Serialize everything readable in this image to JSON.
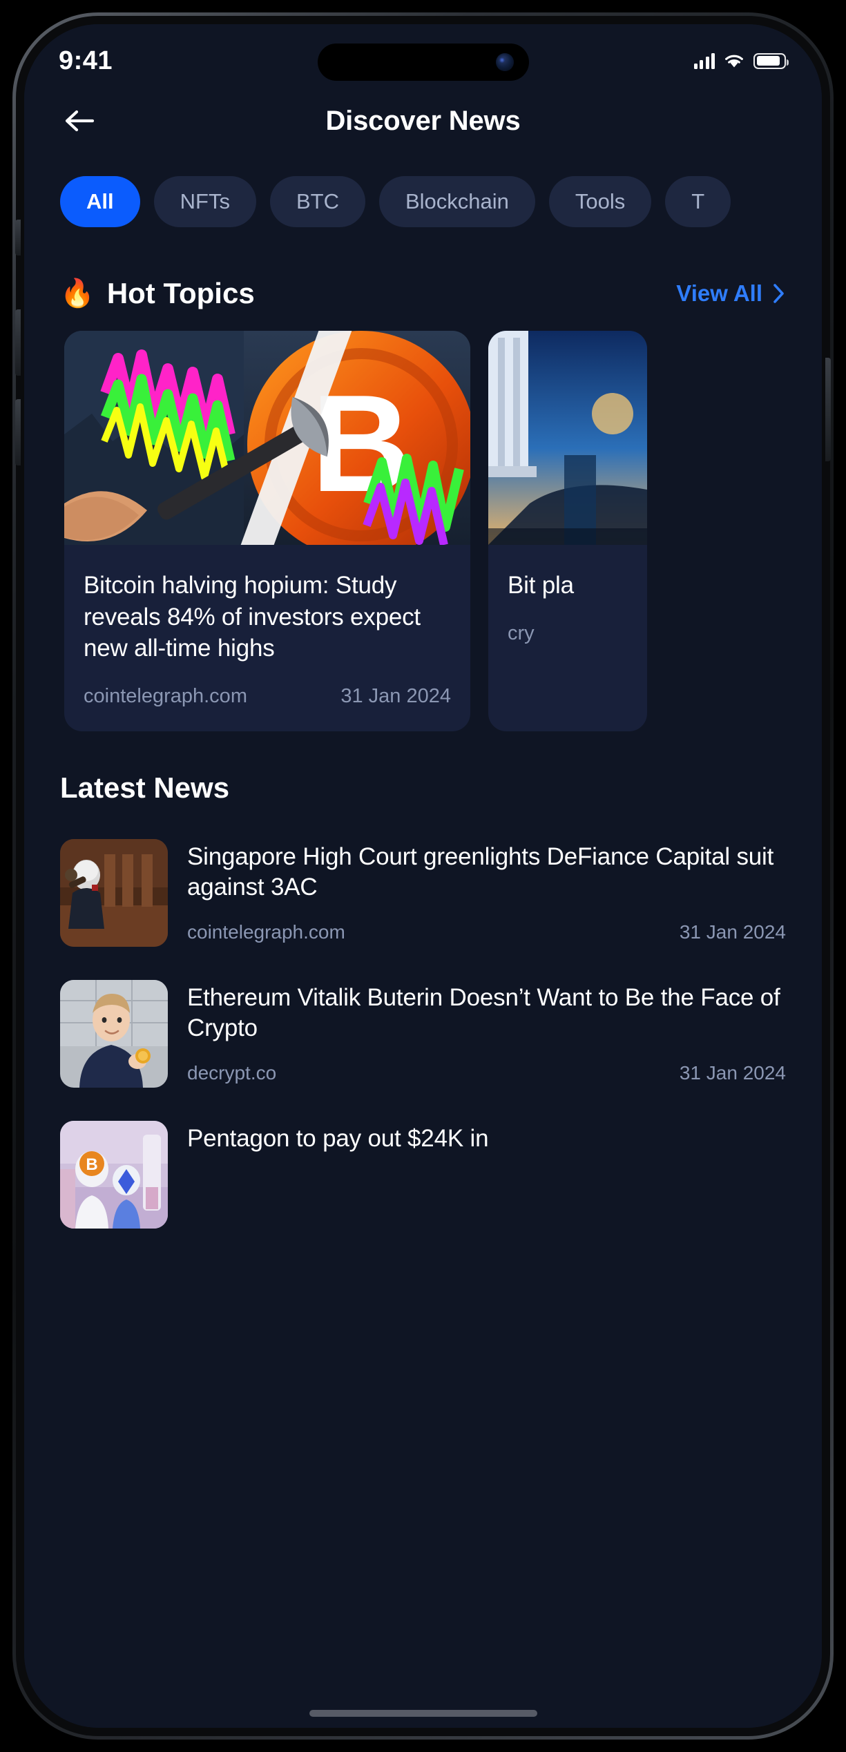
{
  "status_bar": {
    "time": "9:41",
    "signal_icon": "cellular-signal-icon",
    "wifi_icon": "wifi-icon",
    "battery_icon": "battery-icon"
  },
  "header": {
    "back_icon": "back-arrow-icon",
    "title": "Discover News"
  },
  "filters": {
    "items": [
      {
        "label": "All",
        "active": true
      },
      {
        "label": "NFTs",
        "active": false
      },
      {
        "label": "BTC",
        "active": false
      },
      {
        "label": "Blockchain",
        "active": false
      },
      {
        "label": "Tools",
        "active": false
      },
      {
        "label": "T",
        "active": false
      }
    ]
  },
  "hot_topics": {
    "emoji": "🔥",
    "title": "Hot Topics",
    "view_all_label": "View All",
    "chevron_icon": "chevron-right-icon",
    "cards": [
      {
        "title": "Bitcoin halving hopium: Study reveals 84% of investors expect new all-time highs",
        "source": "cointelegraph.com",
        "date": "31 Jan 2024",
        "image": "bitcoin-pickaxe-mining-artwork"
      },
      {
        "title": "Bit pla",
        "source": "cry",
        "date": "",
        "image": "blue-city-tower-artwork"
      }
    ]
  },
  "latest_news": {
    "title": "Latest News",
    "items": [
      {
        "title": "Singapore High Court greenlights DeFiance Capital suit against 3AC",
        "source": "cointelegraph.com",
        "date": "31 Jan 2024",
        "image": "judge-gavel-courtroom-thumbnail"
      },
      {
        "title": "Ethereum Vitalik Buterin Doesn’t Want to Be the Face of Crypto",
        "source": "decrypt.co",
        "date": "31 Jan 2024",
        "image": "vitalik-buterin-portrait-thumbnail"
      },
      {
        "title": "Pentagon to pay out $24K in",
        "source": "",
        "date": "",
        "image": "crypto-lab-scientists-thumbnail"
      }
    ]
  },
  "colors": {
    "background": "#0f1524",
    "card": "#18203a",
    "chip": "#1e2740",
    "accent": "#0b5cfd",
    "link": "#2f7dfb",
    "muted_text": "#8b97b3"
  }
}
